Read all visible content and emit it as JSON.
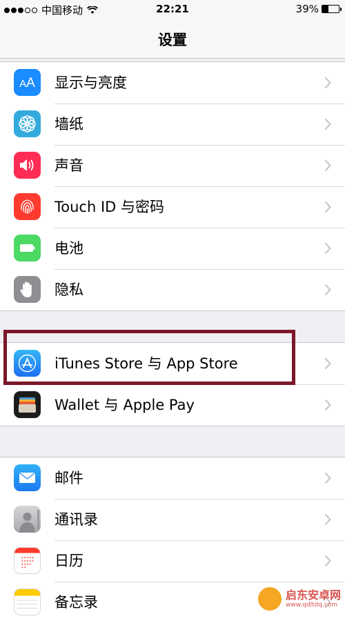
{
  "status": {
    "carrier": "中国移动",
    "time": "22:21",
    "battery": "39%",
    "battery_level": 0.39
  },
  "nav": {
    "title": "设置"
  },
  "groups": [
    [
      {
        "label": "显示与亮度",
        "icon": "display-brightness-icon",
        "color": "#1a8cff"
      },
      {
        "label": "墙纸",
        "icon": "wallpaper-icon",
        "color": "#34aadc"
      },
      {
        "label": "声音",
        "icon": "sound-icon",
        "color": "#ff2d55"
      },
      {
        "label": "Touch ID 与密码",
        "icon": "fingerprint-icon",
        "color": "#ff3b30"
      },
      {
        "label": "电池",
        "icon": "battery-icon",
        "color": "#4cd964"
      },
      {
        "label": "隐私",
        "icon": "privacy-hand-icon",
        "color": "#8e8e93"
      }
    ],
    [
      {
        "label": "iTunes Store 与 App Store",
        "icon": "app-store-icon",
        "color": "#1e90ff"
      },
      {
        "label": "Wallet 与 Apple Pay",
        "icon": "wallet-icon",
        "color": "#1c1c1c"
      }
    ],
    [
      {
        "label": "邮件",
        "icon": "mail-icon",
        "color": "#1a8cff"
      },
      {
        "label": "通讯录",
        "icon": "contacts-icon",
        "color": "#b5b5ba"
      },
      {
        "label": "日历",
        "icon": "calendar-icon",
        "color": "#ffffff"
      },
      {
        "label": "备忘录",
        "icon": "notes-icon",
        "color": "#ffcc00"
      }
    ]
  ],
  "watermark": {
    "name": "启东安卓网",
    "url": "www.qdltdq.com"
  }
}
